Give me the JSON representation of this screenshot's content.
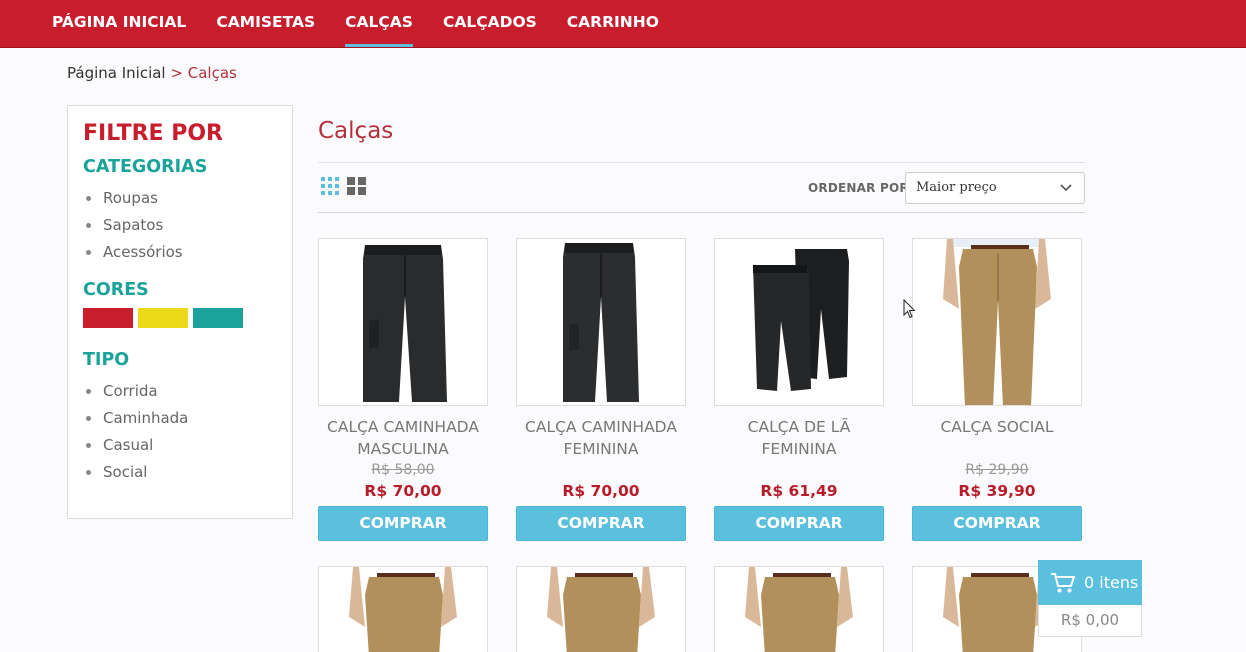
{
  "nav": {
    "items": [
      {
        "label": "PÁGINA INICIAL"
      },
      {
        "label": "CAMISETAS"
      },
      {
        "label": "CALÇAS",
        "active": true
      },
      {
        "label": "CALÇADOS"
      },
      {
        "label": "CARRINHO"
      }
    ]
  },
  "breadcrumb": {
    "home": "Página Inicial",
    "separator": ">",
    "current": "Calças"
  },
  "sidebar": {
    "title": "FILTRE POR",
    "categories": {
      "title": "CATEGORIAS",
      "items": [
        "Roupas",
        "Sapatos",
        "Acessórios"
      ]
    },
    "colors": {
      "title": "CORES",
      "swatches": [
        "#c81d2c",
        "#ecd91a",
        "#1aa39a"
      ]
    },
    "types": {
      "title": "TIPO",
      "items": [
        "Corrida",
        "Caminhada",
        "Casual",
        "Social"
      ]
    }
  },
  "main": {
    "title": "Calças",
    "sort_label": "ORDENAR POR",
    "sort_value": "Maior preço",
    "buy_label": "COMPRAR",
    "products": [
      {
        "name": "CALÇA CAMINHADA MASCULINA",
        "old_price": "R$ 58,00",
        "price": "R$ 70,00"
      },
      {
        "name": "CALÇA CAMINHADA FEMININA",
        "old_price": "",
        "price": "R$ 70,00"
      },
      {
        "name": "CALÇA DE LÃ FEMININA",
        "old_price": "",
        "price": "R$ 61,49"
      },
      {
        "name": "CALÇA SOCIAL",
        "old_price": "R$ 29,90",
        "price": "R$ 39,90"
      }
    ]
  },
  "cart": {
    "items_label": "0 itens",
    "total": "R$ 0,00"
  },
  "colors": {
    "brand_red": "#c81d2c",
    "accent_blue": "#5bc0de",
    "teal": "#1aa39a"
  }
}
